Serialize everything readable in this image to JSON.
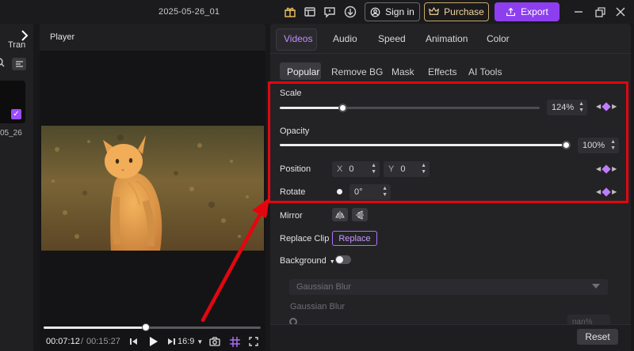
{
  "titlebar": {
    "project_title": "2025-05-26_01",
    "signin_label": "Sign in",
    "purchase_label": "Purchase",
    "export_label": "Export"
  },
  "left": {
    "tab_partial": "Tran",
    "clip_caption": "05_26"
  },
  "player": {
    "title": "Player",
    "current_time": "00:07:12",
    "separator": "/",
    "total_time": "00:15:27",
    "aspect_ratio": "16:9",
    "progress": 0.47
  },
  "panel": {
    "tabs": [
      "Videos",
      "Audio",
      "Speed",
      "Animation",
      "Color"
    ],
    "active_tab": "Videos",
    "subtabs": [
      "Popular",
      "Remove BG",
      "Mask",
      "Effects",
      "AI Tools"
    ],
    "active_subtab": "Popular",
    "scale": {
      "label": "Scale",
      "value": "124%",
      "level": 0.24
    },
    "opacity": {
      "label": "Opacity",
      "value": "100%",
      "level": 1.0
    },
    "position": {
      "label": "Position",
      "x_label": "X",
      "x_value": "0",
      "y_label": "Y",
      "y_value": "0"
    },
    "rotate": {
      "label": "Rotate",
      "value": "0°"
    },
    "mirror": {
      "label": "Mirror"
    },
    "replace_clip": {
      "label": "Replace Clip",
      "button": "Replace"
    },
    "background": {
      "label": "Background",
      "enabled": false
    },
    "background_select": "Gaussian Blur",
    "gaussian_label": "Gaussian Blur",
    "gaussian_value": "nan%",
    "reset_label": "Reset"
  },
  "colors": {
    "accent_purple": "#8d3ff0",
    "highlight_red": "#e4060f",
    "tab_active": "#c48cff"
  }
}
